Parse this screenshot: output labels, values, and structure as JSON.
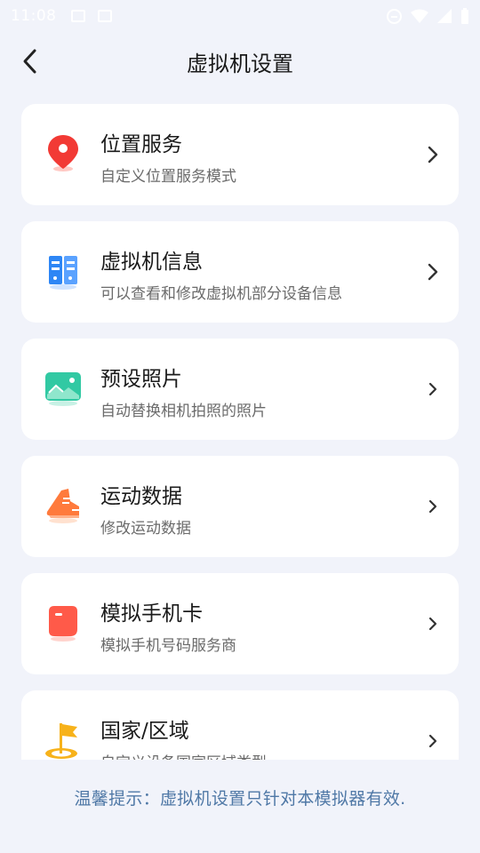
{
  "status_bar": {
    "time": "11:08",
    "icons": [
      "image-icon",
      "android-icon",
      "dnd-icon",
      "wifi-icon",
      "signal-icon",
      "battery-icon"
    ]
  },
  "header": {
    "title": "虚拟机设置",
    "back_icon": "chevron-left-icon"
  },
  "items": [
    {
      "id": "location",
      "name": "位置服务",
      "desc": "自定义位置服务模式",
      "icon": "location-pin-icon",
      "color": "#f23a35"
    },
    {
      "id": "vm-info",
      "name": "虚拟机信息",
      "desc": "可以查看和修改虚拟机部分设备信息",
      "icon": "device-info-icon",
      "color": "#2d86f5"
    },
    {
      "id": "photo",
      "name": "预设照片",
      "desc": "自动替换相机拍照的照片",
      "icon": "photo-icon",
      "color": "#31c9a3"
    },
    {
      "id": "sport",
      "name": "运动数据",
      "desc": "修改运动数据",
      "icon": "sneaker-icon",
      "color": "#ff7a3c"
    },
    {
      "id": "sim",
      "name": "模拟手机卡",
      "desc": "模拟手机号码服务商",
      "icon": "sim-card-icon",
      "color": "#ff5a49"
    },
    {
      "id": "region",
      "name": "国家/区域",
      "desc": "自定义设备国家区域类型",
      "icon": "flag-icon",
      "color": "#f7b21a"
    }
  ],
  "footer": {
    "tip": "温馨提示：虚拟机设置只针对本模拟器有效."
  },
  "colors": {
    "background": "#f1f3fa",
    "card": "#ffffff",
    "tip_text": "#4f78a6"
  }
}
